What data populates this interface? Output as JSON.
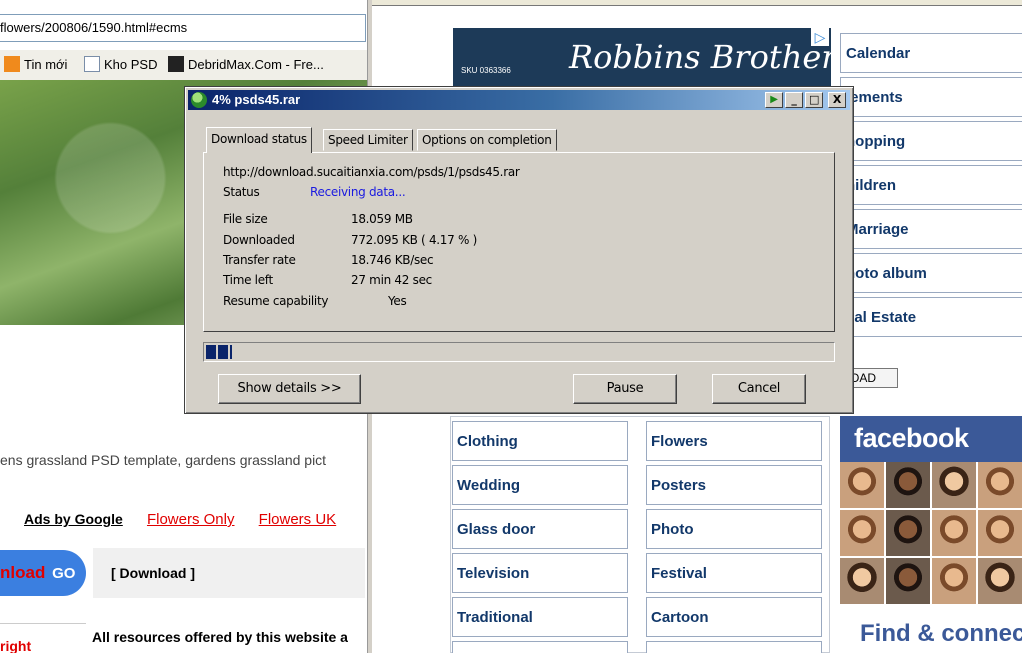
{
  "left_browser": {
    "address": "flowers/200806/1590.html#ecms",
    "bookmarks": [
      {
        "label": "Tin mới",
        "icon": "rss-icon"
      },
      {
        "label": "Kho PSD",
        "icon": "page-icon"
      },
      {
        "label": "DebridMax.Com - Fre...",
        "icon": "dm-icon"
      }
    ],
    "description": "ens grassland PSD template, gardens grassland pict",
    "ads_by_google": "Ads by Google",
    "ad_links": [
      "Flowers Only",
      "Flowers UK"
    ],
    "download_button": "nload",
    "download_go": "GO",
    "download_label": "[ Download ]",
    "resource_left": "right",
    "resource_text": "All resources offered by this website a"
  },
  "right_browser": {
    "banner": {
      "sku": "SKU 0363366",
      "brand": "Robbins Brothers"
    },
    "categories_right": [
      "Calendar",
      "lements",
      "hopping",
      "hildren",
      "Marriage",
      "hoto album",
      "eal Estate"
    ],
    "load_button": "OAD",
    "category_grid": [
      [
        "Clothing",
        "Flowers"
      ],
      [
        "Wedding",
        "Posters"
      ],
      [
        "Glass door",
        "Photo"
      ],
      [
        "Television",
        "Festival"
      ],
      [
        "Traditional",
        "Cartoon"
      ]
    ],
    "facebook": {
      "brand": "facebook",
      "tagline": "Find & connec"
    }
  },
  "dialog": {
    "title": "4% psds45.rar",
    "tabs": [
      "Download status",
      "Speed Limiter",
      "Options on completion"
    ],
    "active_tab": "Download status",
    "url": "http://download.sucaitianxia.com/psds/1/psds45.rar",
    "status_label": "Status",
    "status_value": "Receiving data...",
    "file_size_label": "File size",
    "file_size_value": "18.059  MB",
    "downloaded_label": "Downloaded",
    "downloaded_value": "772.095  KB  ( 4.17 % )",
    "transfer_rate_label": "Transfer rate",
    "transfer_rate_value": "18.746  KB/sec",
    "time_left_label": "Time left",
    "time_left_value": "27 min 42 sec",
    "resume_label": "Resume capability",
    "resume_value": "Yes",
    "progress_fraction": 0.0417,
    "buttons": {
      "details": "Show details >>",
      "pause": "Pause",
      "cancel": "Cancel"
    },
    "titlebar_buttons": {
      "minimize": "_",
      "maximize": "□",
      "close": "X",
      "play": "▶"
    }
  }
}
